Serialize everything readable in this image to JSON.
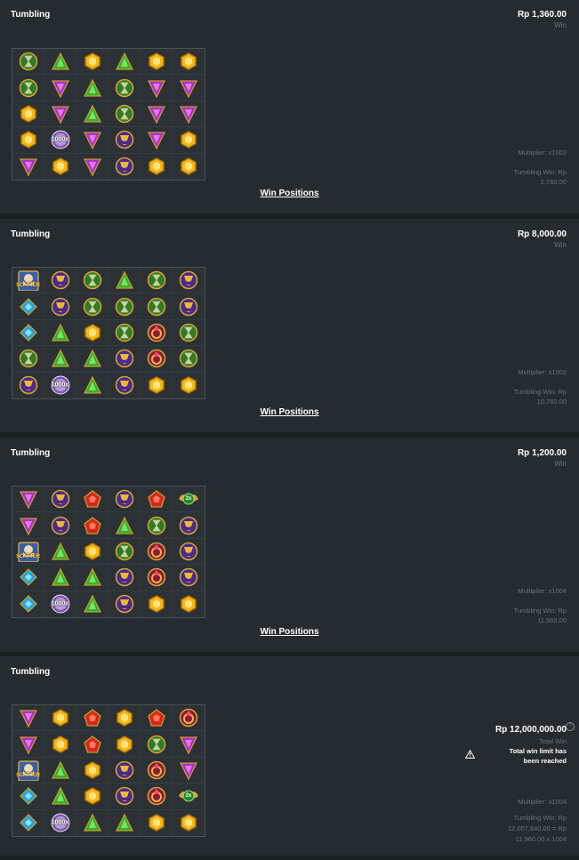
{
  "colors": {
    "background": "#1a1f22",
    "panel": "#252b2e",
    "muted_text": "#6c7378",
    "gold_gem": "#f4b71a",
    "green_gem": "#2fb52a",
    "purple_gem": "#b02fc7",
    "red_gem": "#d8261e",
    "blue_gem": "#1ea6e0"
  },
  "symbol_legend": {
    "Y": "gold-hexagon-gem",
    "G": "green-triangle-gem",
    "P": "purple-inverted-triangle-gem",
    "R": "red-pentagon-gem",
    "B": "blue-diamond-gem",
    "H": "green-hourglass",
    "C": "purple-chalice",
    "O": "purple-orb-ring",
    "K": "red-ruby-ring",
    "S": "scatter-zeus",
    "M": "multiplier-orb",
    "X": "winged-2x-multiplier"
  },
  "panels": [
    {
      "title": "Tumbling",
      "amount": "Rp 1,360.00",
      "amount_sub": "Win",
      "grid": [
        [
          "H",
          "G",
          "Y",
          "G",
          "Y",
          "Y"
        ],
        [
          "H",
          "P",
          "G",
          "H",
          "P",
          "P"
        ],
        [
          "Y",
          "P",
          "G",
          "H",
          "P",
          "P"
        ],
        [
          "Y",
          "M",
          "P",
          "C",
          "P",
          "Y"
        ],
        [
          "P",
          "Y",
          "P",
          "C",
          "Y",
          "Y"
        ]
      ],
      "multiplier_text": "1000x",
      "multiplier_line": "Multiplier: x1002",
      "tumbling_line1": "Tumbling Win: Rp",
      "tumbling_line2": "2,760.00",
      "link": "Win Positions"
    },
    {
      "title": "Tumbling",
      "amount": "Rp 8,000.00",
      "amount_sub": "Win",
      "grid": [
        [
          "S",
          "C",
          "H",
          "G",
          "H",
          "C"
        ],
        [
          "B",
          "C",
          "H",
          "H",
          "H",
          "C"
        ],
        [
          "B",
          "G",
          "Y",
          "H",
          "K",
          "H"
        ],
        [
          "H",
          "G",
          "G",
          "C",
          "K",
          "H"
        ],
        [
          "C",
          "M",
          "G",
          "C",
          "Y",
          "Y"
        ]
      ],
      "multiplier_text": "1000x",
      "scatter_text": "SCATTER",
      "multiplier_line": "Multiplier: x1002",
      "tumbling_line1": "Tumbling Win: Rp",
      "tumbling_line2": "10,760.00",
      "link": "Win Positions"
    },
    {
      "title": "Tumbling",
      "amount": "Rp 1,200.00",
      "amount_sub": "Win",
      "grid": [
        [
          "P",
          "C",
          "R",
          "C",
          "R",
          "X"
        ],
        [
          "P",
          "C",
          "R",
          "G",
          "H",
          "C"
        ],
        [
          "S",
          "G",
          "Y",
          "H",
          "K",
          "C"
        ],
        [
          "B",
          "G",
          "G",
          "C",
          "K",
          "C"
        ],
        [
          "B",
          "M",
          "G",
          "C",
          "Y",
          "Y"
        ]
      ],
      "multiplier_text": "1000x",
      "scatter_text": "SCATTER",
      "winged_text": "2x",
      "multiplier_line": "Multiplier: x1004",
      "tumbling_line1": "Tumbling Win: Rp",
      "tumbling_line2": "11,960.00",
      "link": "Win Positions"
    },
    {
      "title": "Tumbling",
      "amount": "Rp 12,000,000.00",
      "amount_sub": "Total Win",
      "info_icon": "?",
      "warning_icon": "warning-triangle-icon",
      "warning_text": "Total win limit has been reached",
      "grid": [
        [
          "P",
          "Y",
          "R",
          "Y",
          "R",
          "K"
        ],
        [
          "P",
          "Y",
          "R",
          "Y",
          "H",
          "P"
        ],
        [
          "S",
          "G",
          "Y",
          "C",
          "K",
          "P"
        ],
        [
          "B",
          "G",
          "Y",
          "C",
          "K",
          "X"
        ],
        [
          "B",
          "M",
          "G",
          "G",
          "Y",
          "Y"
        ]
      ],
      "multiplier_text": "1000x",
      "scatter_text": "SCATTER",
      "winged_text": "2x",
      "multiplier_line": "Multiplier: x1004",
      "tumbling_line1": "Tumbling Win: Rp",
      "tumbling_line2": "12,007,840.00 = Rp",
      "tumbling_line3": "11,960.00 x 1004"
    }
  ]
}
